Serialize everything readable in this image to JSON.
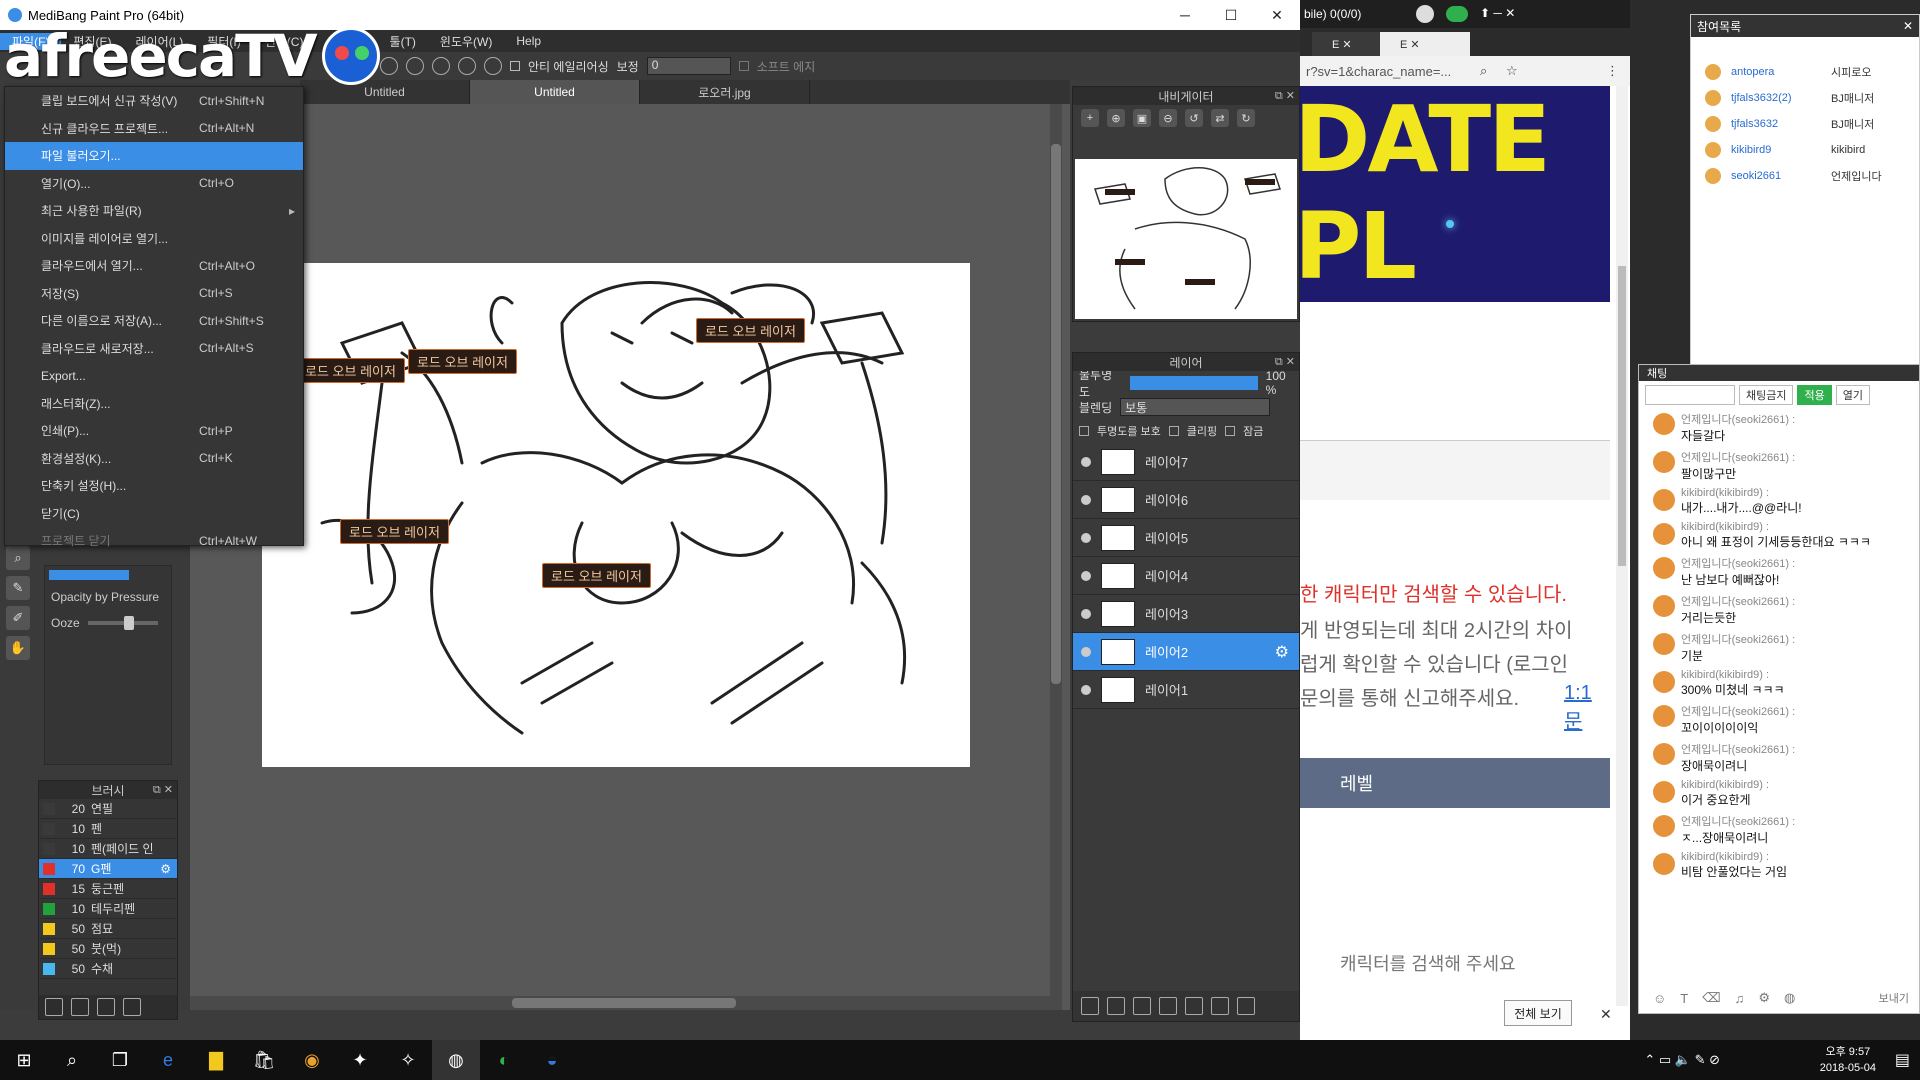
{
  "medibang": {
    "title": "MediBang Paint Pro (64bit)",
    "menubar": [
      "파일(F)",
      "편집(E)",
      "레이어(L)",
      "필터(I)",
      "선택(C)",
      "표시(V)",
      "툴(T)",
      "윈도우(W)",
      "Help"
    ],
    "toolbar": {
      "anti_alias": "안티 에일리어싱",
      "correction_label": "보정",
      "correction_value": "0",
      "soft_edge": "소프트 에지"
    },
    "tabs": [
      "Untitled",
      "Untitled",
      "로오러.jpg"
    ],
    "file_menu": [
      {
        "label": "클립 보드에서 신규 작성(V)",
        "shortcut": "Ctrl+Shift+N"
      },
      {
        "label": "신규 클라우드 프로젝트...",
        "shortcut": "Ctrl+Alt+N"
      },
      {
        "label": "파일 불러오기...",
        "shortcut": ""
      },
      {
        "label": "열기(O)...",
        "shortcut": "Ctrl+O"
      },
      {
        "label": "최근 사용한 파일(R)",
        "shortcut": ""
      },
      {
        "label": "이미지를 레이어로 열기...",
        "shortcut": ""
      },
      {
        "label": "클라우드에서 열기...",
        "shortcut": "Ctrl+Alt+O"
      },
      {
        "label": "저장(S)",
        "shortcut": "Ctrl+S"
      },
      {
        "label": "다른 이름으로 저장(A)...",
        "shortcut": "Ctrl+Shift+S"
      },
      {
        "label": "클라우드로 새로저장...",
        "shortcut": "Ctrl+Alt+S"
      },
      {
        "label": "Export...",
        "shortcut": ""
      },
      {
        "label": "래스터화(Z)...",
        "shortcut": ""
      },
      {
        "label": "인쇄(P)...",
        "shortcut": "Ctrl+P"
      },
      {
        "label": "환경설정(K)...",
        "shortcut": "Ctrl+K"
      },
      {
        "label": "단축키 설정(H)...",
        "shortcut": ""
      },
      {
        "label": "닫기(C)",
        "shortcut": ""
      },
      {
        "label": "프로젝트 닫기",
        "shortcut": "Ctrl+Alt+W"
      }
    ],
    "brush_settings": {
      "opacity_by_pressure": "Opacity by Pressure",
      "ooze": "Ooze",
      "size_hint": "100 %"
    },
    "brush_panel": {
      "title": "브러시",
      "items": [
        {
          "size": "20",
          "name": "연필",
          "color": "#3a3a3a"
        },
        {
          "size": "10",
          "name": "펜",
          "color": "#3a3a3a"
        },
        {
          "size": "10",
          "name": "펜(페이드 인",
          "color": "#3a3a3a"
        },
        {
          "size": "70",
          "name": "G펜",
          "color": "#e0302a"
        },
        {
          "size": "15",
          "name": "둥근펜",
          "color": "#e0302a"
        },
        {
          "size": "10",
          "name": "테두리펜",
          "color": "#22a23a"
        },
        {
          "size": "50",
          "name": "점묘",
          "color": "#f2c81e"
        },
        {
          "size": "50",
          "name": "붓(먹)",
          "color": "#f2c81e"
        },
        {
          "size": "50",
          "name": "수채",
          "color": "#4ab8f0"
        }
      ]
    },
    "navigator": {
      "title": "내비게이터"
    },
    "layers": {
      "title": "레이어",
      "opacity_label": "불투명도",
      "opacity_value": "100 %",
      "blend_label": "블렌딩",
      "blend_value": "보통",
      "protect_label": "투명도를 보호",
      "clipping_label": "클리핑",
      "lock_label": "잠금",
      "items": [
        "레이어7",
        "레이어6",
        "레이어5",
        "레이어4",
        "레이어3",
        "레이어2",
        "레이어1"
      ]
    },
    "canvas_tags": [
      "로드 오브 레이저",
      "로드 오브 레이저",
      "로드 오브 레이저",
      "로드 오브 레이저",
      "로드 오브 레이저"
    ]
  },
  "logo": "afreecaTV",
  "browser": {
    "top_text": "bile) 0(0/0)",
    "url": "r?sv=1&charac_name=...",
    "banner": "DATE PL",
    "red_text": "한 캐릭터만 검색할 수 있습니다.",
    "grey1": "게 반영되는데 최대 2시간의 차이",
    "grey2": "럽게 확인할 수 있습니다 (로그인",
    "grey3": "문의를 통해 신고해주세요.",
    "link": "1:1문",
    "level": "레벨",
    "search_hint": "캐릭터를 검색해 주세요",
    "view_all": "전체 보기"
  },
  "participants": {
    "title": "참여목록",
    "rows": [
      {
        "id": "antopera",
        "name": "시피로오"
      },
      {
        "id": "tjfals3632(2)",
        "name": "BJ매니저"
      },
      {
        "id": "tjfals3632",
        "name": "BJ매니저"
      },
      {
        "id": "kikibird9",
        "name": "kikibird"
      },
      {
        "id": "seoki2661",
        "name": "언제입니다"
      }
    ]
  },
  "chat": {
    "title": "채팅",
    "controls": {
      "filter": "채팅금지",
      "apply": "적용",
      "open": "열기"
    },
    "messages": [
      {
        "user": "언제입니다(seoki2661) :",
        "text": "자들갈다"
      },
      {
        "user": "언제입니다(seoki2661) :",
        "text": "팔이많구만"
      },
      {
        "user": "kikibird(kikibird9) :",
        "text": "내가....내가....@@라니!"
      },
      {
        "user": "kikibird(kikibird9) :",
        "text": "아니 왜 표정이 기세등등한대요 ㅋㅋㅋ"
      },
      {
        "user": "언제입니다(seoki2661) :",
        "text": "난 남보다 예뻐잖아!"
      },
      {
        "user": "언제입니다(seoki2661) :",
        "text": "거리는듯한"
      },
      {
        "user": "언제입니다(seoki2661) :",
        "text": "기분"
      },
      {
        "user": "kikibird(kikibird9) :",
        "text": "300% 미쳤네 ㅋㅋㅋ"
      },
      {
        "user": "언제입니다(seoki2661) :",
        "text": "꼬이이이이이익"
      },
      {
        "user": "언제입니다(seoki2661) :",
        "text": "장애묵이려니"
      },
      {
        "user": "kikibird(kikibird9) :",
        "text": "이거 중요한게"
      },
      {
        "user": "언제입니다(seoki2661) :",
        "text": "ㅈ...장애묵이려니"
      },
      {
        "user": "kikibird(kikibird9) :",
        "text": "비탐 안풀었다는 거임"
      }
    ],
    "send": "보내기"
  },
  "taskbar": {
    "time": "오후 9:57",
    "date": "2018-05-04"
  }
}
